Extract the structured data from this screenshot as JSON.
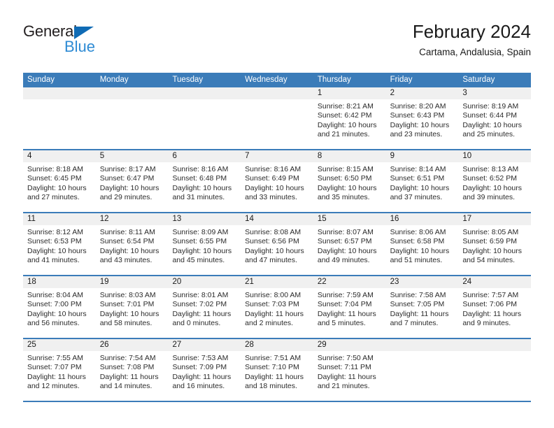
{
  "brand": {
    "word_one": "General",
    "word_two": "Blue",
    "triangle_color": "#0f6bb5",
    "blue_text_color": "#2e8bd4"
  },
  "header": {
    "title": "February 2024",
    "subtitle": "Cartama, Andalusia, Spain"
  },
  "theme": {
    "header_blue": "#3b7cb9",
    "daynum_band": "#f0f0f0",
    "text": "#2b2b2b"
  },
  "calendar": {
    "weekdays": [
      "Sunday",
      "Monday",
      "Tuesday",
      "Wednesday",
      "Thursday",
      "Friday",
      "Saturday"
    ],
    "weeks": [
      [
        {
          "day": "",
          "lines": []
        },
        {
          "day": "",
          "lines": []
        },
        {
          "day": "",
          "lines": []
        },
        {
          "day": "",
          "lines": []
        },
        {
          "day": "1",
          "lines": [
            "Sunrise: 8:21 AM",
            "Sunset: 6:42 PM",
            "Daylight: 10 hours",
            "and 21 minutes."
          ]
        },
        {
          "day": "2",
          "lines": [
            "Sunrise: 8:20 AM",
            "Sunset: 6:43 PM",
            "Daylight: 10 hours",
            "and 23 minutes."
          ]
        },
        {
          "day": "3",
          "lines": [
            "Sunrise: 8:19 AM",
            "Sunset: 6:44 PM",
            "Daylight: 10 hours",
            "and 25 minutes."
          ]
        }
      ],
      [
        {
          "day": "4",
          "lines": [
            "Sunrise: 8:18 AM",
            "Sunset: 6:45 PM",
            "Daylight: 10 hours",
            "and 27 minutes."
          ]
        },
        {
          "day": "5",
          "lines": [
            "Sunrise: 8:17 AM",
            "Sunset: 6:47 PM",
            "Daylight: 10 hours",
            "and 29 minutes."
          ]
        },
        {
          "day": "6",
          "lines": [
            "Sunrise: 8:16 AM",
            "Sunset: 6:48 PM",
            "Daylight: 10 hours",
            "and 31 minutes."
          ]
        },
        {
          "day": "7",
          "lines": [
            "Sunrise: 8:16 AM",
            "Sunset: 6:49 PM",
            "Daylight: 10 hours",
            "and 33 minutes."
          ]
        },
        {
          "day": "8",
          "lines": [
            "Sunrise: 8:15 AM",
            "Sunset: 6:50 PM",
            "Daylight: 10 hours",
            "and 35 minutes."
          ]
        },
        {
          "day": "9",
          "lines": [
            "Sunrise: 8:14 AM",
            "Sunset: 6:51 PM",
            "Daylight: 10 hours",
            "and 37 minutes."
          ]
        },
        {
          "day": "10",
          "lines": [
            "Sunrise: 8:13 AM",
            "Sunset: 6:52 PM",
            "Daylight: 10 hours",
            "and 39 minutes."
          ]
        }
      ],
      [
        {
          "day": "11",
          "lines": [
            "Sunrise: 8:12 AM",
            "Sunset: 6:53 PM",
            "Daylight: 10 hours",
            "and 41 minutes."
          ]
        },
        {
          "day": "12",
          "lines": [
            "Sunrise: 8:11 AM",
            "Sunset: 6:54 PM",
            "Daylight: 10 hours",
            "and 43 minutes."
          ]
        },
        {
          "day": "13",
          "lines": [
            "Sunrise: 8:09 AM",
            "Sunset: 6:55 PM",
            "Daylight: 10 hours",
            "and 45 minutes."
          ]
        },
        {
          "day": "14",
          "lines": [
            "Sunrise: 8:08 AM",
            "Sunset: 6:56 PM",
            "Daylight: 10 hours",
            "and 47 minutes."
          ]
        },
        {
          "day": "15",
          "lines": [
            "Sunrise: 8:07 AM",
            "Sunset: 6:57 PM",
            "Daylight: 10 hours",
            "and 49 minutes."
          ]
        },
        {
          "day": "16",
          "lines": [
            "Sunrise: 8:06 AM",
            "Sunset: 6:58 PM",
            "Daylight: 10 hours",
            "and 51 minutes."
          ]
        },
        {
          "day": "17",
          "lines": [
            "Sunrise: 8:05 AM",
            "Sunset: 6:59 PM",
            "Daylight: 10 hours",
            "and 54 minutes."
          ]
        }
      ],
      [
        {
          "day": "18",
          "lines": [
            "Sunrise: 8:04 AM",
            "Sunset: 7:00 PM",
            "Daylight: 10 hours",
            "and 56 minutes."
          ]
        },
        {
          "day": "19",
          "lines": [
            "Sunrise: 8:03 AM",
            "Sunset: 7:01 PM",
            "Daylight: 10 hours",
            "and 58 minutes."
          ]
        },
        {
          "day": "20",
          "lines": [
            "Sunrise: 8:01 AM",
            "Sunset: 7:02 PM",
            "Daylight: 11 hours",
            "and 0 minutes."
          ]
        },
        {
          "day": "21",
          "lines": [
            "Sunrise: 8:00 AM",
            "Sunset: 7:03 PM",
            "Daylight: 11 hours",
            "and 2 minutes."
          ]
        },
        {
          "day": "22",
          "lines": [
            "Sunrise: 7:59 AM",
            "Sunset: 7:04 PM",
            "Daylight: 11 hours",
            "and 5 minutes."
          ]
        },
        {
          "day": "23",
          "lines": [
            "Sunrise: 7:58 AM",
            "Sunset: 7:05 PM",
            "Daylight: 11 hours",
            "and 7 minutes."
          ]
        },
        {
          "day": "24",
          "lines": [
            "Sunrise: 7:57 AM",
            "Sunset: 7:06 PM",
            "Daylight: 11 hours",
            "and 9 minutes."
          ]
        }
      ],
      [
        {
          "day": "25",
          "lines": [
            "Sunrise: 7:55 AM",
            "Sunset: 7:07 PM",
            "Daylight: 11 hours",
            "and 12 minutes."
          ]
        },
        {
          "day": "26",
          "lines": [
            "Sunrise: 7:54 AM",
            "Sunset: 7:08 PM",
            "Daylight: 11 hours",
            "and 14 minutes."
          ]
        },
        {
          "day": "27",
          "lines": [
            "Sunrise: 7:53 AM",
            "Sunset: 7:09 PM",
            "Daylight: 11 hours",
            "and 16 minutes."
          ]
        },
        {
          "day": "28",
          "lines": [
            "Sunrise: 7:51 AM",
            "Sunset: 7:10 PM",
            "Daylight: 11 hours",
            "and 18 minutes."
          ]
        },
        {
          "day": "29",
          "lines": [
            "Sunrise: 7:50 AM",
            "Sunset: 7:11 PM",
            "Daylight: 11 hours",
            "and 21 minutes."
          ]
        },
        {
          "day": "",
          "lines": []
        },
        {
          "day": "",
          "lines": []
        }
      ]
    ]
  }
}
